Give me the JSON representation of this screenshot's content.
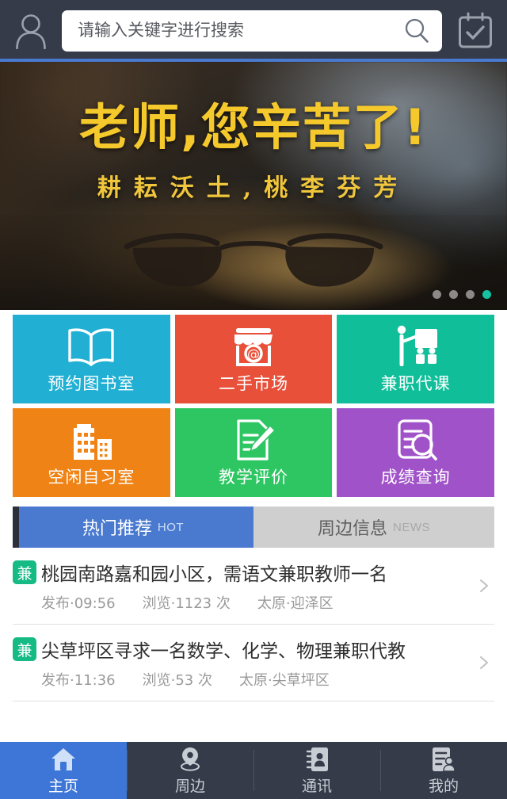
{
  "header": {
    "user_icon": "user-avatar-icon",
    "search": {
      "placeholder": "请输入关键字进行搜索",
      "value": "",
      "icon": "search-icon"
    },
    "calendar_icon": "calendar-check-icon",
    "bg_color": "#353b49",
    "accent_color": "#4a7ad0"
  },
  "banner": {
    "title": "老师,您辛苦了!",
    "subtitle": "耕耘沃土,桃李芬芳",
    "title_color": "#f5c92b",
    "dots_total": 4,
    "dots_active_index": 3,
    "active_dot_color": "#13c2a0"
  },
  "tiles": [
    {
      "label": "预约图书室",
      "color": "#21b0d3",
      "icon": "open-book-icon"
    },
    {
      "label": "二手市场",
      "color": "#e8503a",
      "icon": "shop-at-icon"
    },
    {
      "label": "兼职代课",
      "color": "#10bf9a",
      "icon": "teacher-whiteboard-icon"
    },
    {
      "label": "空闲自习室",
      "color": "#ef8316",
      "icon": "building-icon"
    },
    {
      "label": "教学评价",
      "color": "#2ec662",
      "icon": "document-pencil-icon"
    },
    {
      "label": "成绩查询",
      "color": "#a052c8",
      "icon": "document-search-icon"
    }
  ],
  "tabs": [
    {
      "label": "热门推荐",
      "sub": "HOT",
      "active": true,
      "color": "#4a7ad0"
    },
    {
      "label": "周边信息",
      "sub": "NEWS",
      "active": false,
      "color": "#cfcfcf"
    }
  ],
  "list": [
    {
      "badge": "兼",
      "title": "桃园南路嘉和园小区，需语文兼职教师一名",
      "published": "发布·09:56",
      "views": "浏览·1123 次",
      "location": "太原·迎泽区",
      "chevron": "chevron-right-icon"
    },
    {
      "badge": "兼",
      "title": "尖草坪区寻求一名数学、化学、物理兼职代教",
      "published": "发布·11:36",
      "views": "浏览·53 次",
      "location": "太原·尖草坪区",
      "chevron": "chevron-right-icon"
    }
  ],
  "bottom_nav": [
    {
      "label": "主页",
      "icon": "home-icon",
      "active": true
    },
    {
      "label": "周边",
      "icon": "location-pin-icon",
      "active": false
    },
    {
      "label": "通讯",
      "icon": "contacts-book-icon",
      "active": false
    },
    {
      "label": "我的",
      "icon": "profile-card-icon",
      "active": false
    }
  ]
}
